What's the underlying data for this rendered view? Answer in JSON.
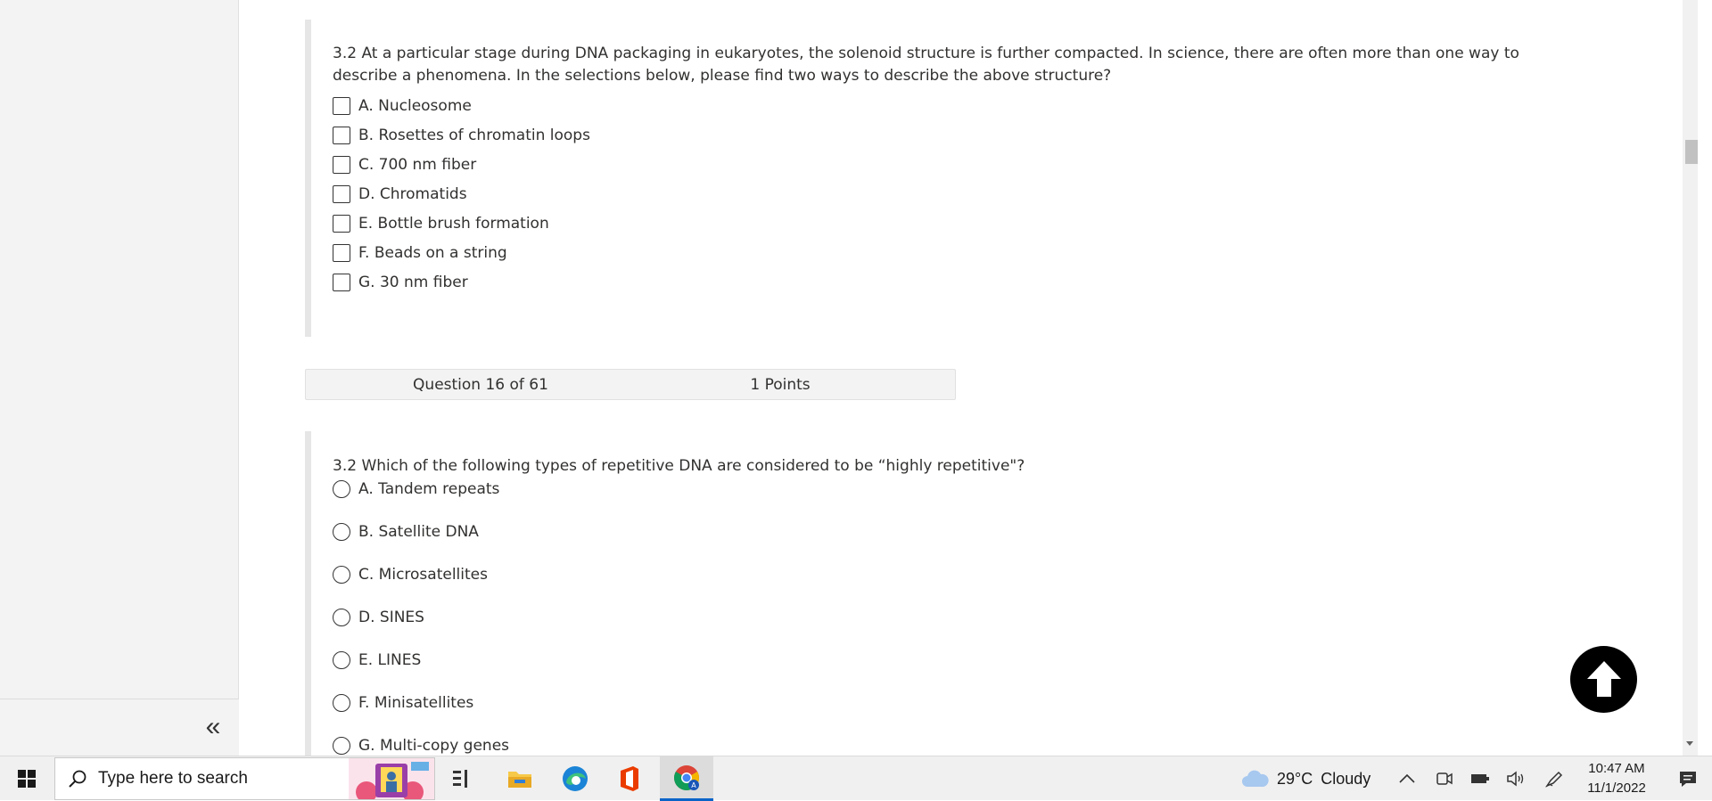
{
  "left_panel": {
    "collapse_glyph": "«"
  },
  "question_15": {
    "text": "3.2 At a particular stage during DNA packaging in eukaryotes, the solenoid structure is further compacted. In science, there are often more than one way to describe a phenomena. In the selections below, please find two ways to describe the above structure?",
    "options": [
      "A. Nucleosome",
      "B. Rosettes of chromatin loops",
      "C. 700 nm fiber",
      "D. Chromatids",
      "E. Bottle brush formation",
      "F. Beads on a string",
      "G. 30 nm fiber"
    ]
  },
  "question_16_header": {
    "number": "Question 16 of 61",
    "points": "1 Points"
  },
  "question_16": {
    "text": "3.2 Which of the following types of repetitive DNA are considered to be “highly repetitive\"?",
    "options": [
      "A. Tandem repeats",
      "B. Satellite DNA",
      "C. Microsatellites",
      "D. SINES",
      "E. LINES",
      "F. Minisatellites",
      "G. Multi-copy genes"
    ]
  },
  "taskbar": {
    "search_placeholder": "Type here to search",
    "weather_temp": "29°C",
    "weather_desc": "Cloudy",
    "time": "10:47 AM",
    "date": "11/1/2022",
    "apps": [
      "task-view-icon",
      "file-explorer-icon",
      "edge-icon",
      "office-icon",
      "chrome-icon"
    ]
  },
  "colors": {
    "accent": "#0a64c8",
    "question_border": "#e6e6e6",
    "header_bg": "#f3f3f3"
  }
}
